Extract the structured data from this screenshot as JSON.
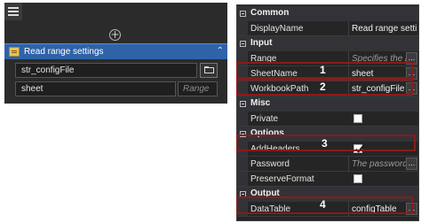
{
  "designer": {
    "activity_title": "Read range settings",
    "workbook_value": "str_configFile",
    "sheet_value": "sheet",
    "range_placeholder": "Range"
  },
  "properties": {
    "categories": {
      "common": "Common",
      "input": "Input",
      "misc": "Misc",
      "options": "Options",
      "output": "Output"
    },
    "rows": {
      "display_name": {
        "name": "DisplayName",
        "value": "Read range setting"
      },
      "range": {
        "name": "Range",
        "value": "Specifies the r"
      },
      "sheet_name": {
        "name": "SheetName",
        "value": "sheet"
      },
      "workbook_path": {
        "name": "WorkbookPath",
        "value": "str_configFile"
      },
      "private": {
        "name": "Private",
        "checked": false
      },
      "add_headers": {
        "name": "AddHeaders",
        "checked": true
      },
      "password": {
        "name": "Password",
        "value": "The password"
      },
      "preserve_format": {
        "name": "PreserveFormat",
        "checked": false
      },
      "data_table": {
        "name": "DataTable",
        "value": "configTable"
      }
    },
    "ellipsis": "..."
  },
  "annotations": [
    "1",
    "2",
    "3",
    "4"
  ],
  "colors": {
    "highlight": "#8b1a1a",
    "activity_header": "#2f63a8",
    "panel_background": "#252526"
  }
}
